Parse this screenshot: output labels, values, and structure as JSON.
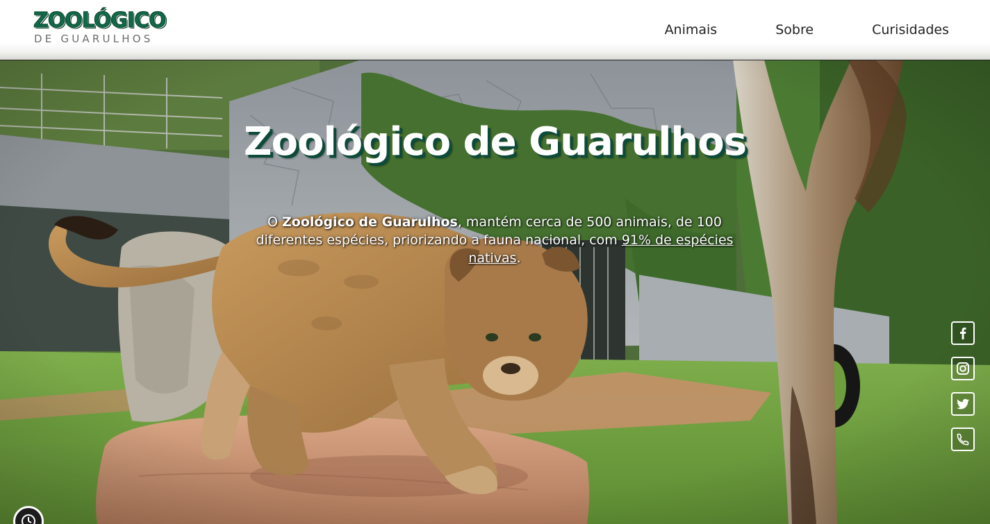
{
  "header": {
    "logo_main": "ZOOLÓGICO",
    "logo_sub": "DE GUARULHOS",
    "nav": {
      "animais": "Animais",
      "sobre": "Sobre",
      "curiosidades": "Curisidades"
    }
  },
  "hero": {
    "title": "Zoológico de Guarulhos",
    "text_before_bold": "O ",
    "text_bold": "Zoológico de Guarulhos",
    "text_middle": ", mantém cerca de 500 animais, de 100 diferentes espécies, priorizando a fauna nacional, com ",
    "text_link": "91% de espécies nativas",
    "text_end": "."
  },
  "social": {
    "icons": [
      "facebook-icon",
      "instagram-icon",
      "twitter-icon",
      "phone-icon"
    ]
  },
  "colors": {
    "brand_green": "#0f6b4a",
    "title_shadow": "#0c4a3a"
  }
}
